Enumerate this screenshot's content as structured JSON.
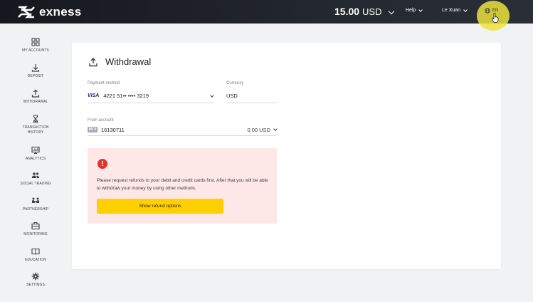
{
  "header": {
    "brand": "exness",
    "balance_amount": "15.00",
    "balance_currency": "USD",
    "help_label": "Help",
    "user_label": "Le Xuan",
    "lang_label": "EN"
  },
  "sidebar": {
    "items": [
      {
        "label": "MY ACCOUNTS",
        "icon": "grid-icon"
      },
      {
        "label": "DEPOSIT",
        "icon": "download-icon"
      },
      {
        "label": "WITHDRAWAL",
        "icon": "upload-icon"
      },
      {
        "label": "TRANSACTION HISTORY",
        "icon": "hourglass-icon"
      },
      {
        "label": "ANALYTICS",
        "icon": "chart-icon"
      },
      {
        "label": "SOCIAL TRADING",
        "icon": "people-icon"
      },
      {
        "label": "PARTNERSHIP",
        "icon": "handshake-icon"
      },
      {
        "label": "MONITORING",
        "icon": "briefcase-icon"
      },
      {
        "label": "EDUCATION",
        "icon": "book-icon"
      },
      {
        "label": "SETTINGS",
        "icon": "gear-icon"
      }
    ]
  },
  "withdrawal": {
    "title": "Withdrawal",
    "payment_method_label": "Payment method",
    "payment_brand": "VISA",
    "payment_card": "4221 51•• •••• 3219",
    "currency_label": "Currency",
    "currency_value": "USD",
    "from_account_label": "From account",
    "account_badge": "MT4",
    "account_number": "16130711",
    "account_balance": "0.00 USD",
    "alert_text": "Please request refunds to your debit and credit cards first. After that you will be able to withdraw your money by using other methods.",
    "alert_button": "Show refund options"
  },
  "colors": {
    "topbar": "#1b1e23",
    "accent_yellow": "#ffd000",
    "alert_bg": "#fde7e7",
    "alert_icon": "#e0342f"
  }
}
